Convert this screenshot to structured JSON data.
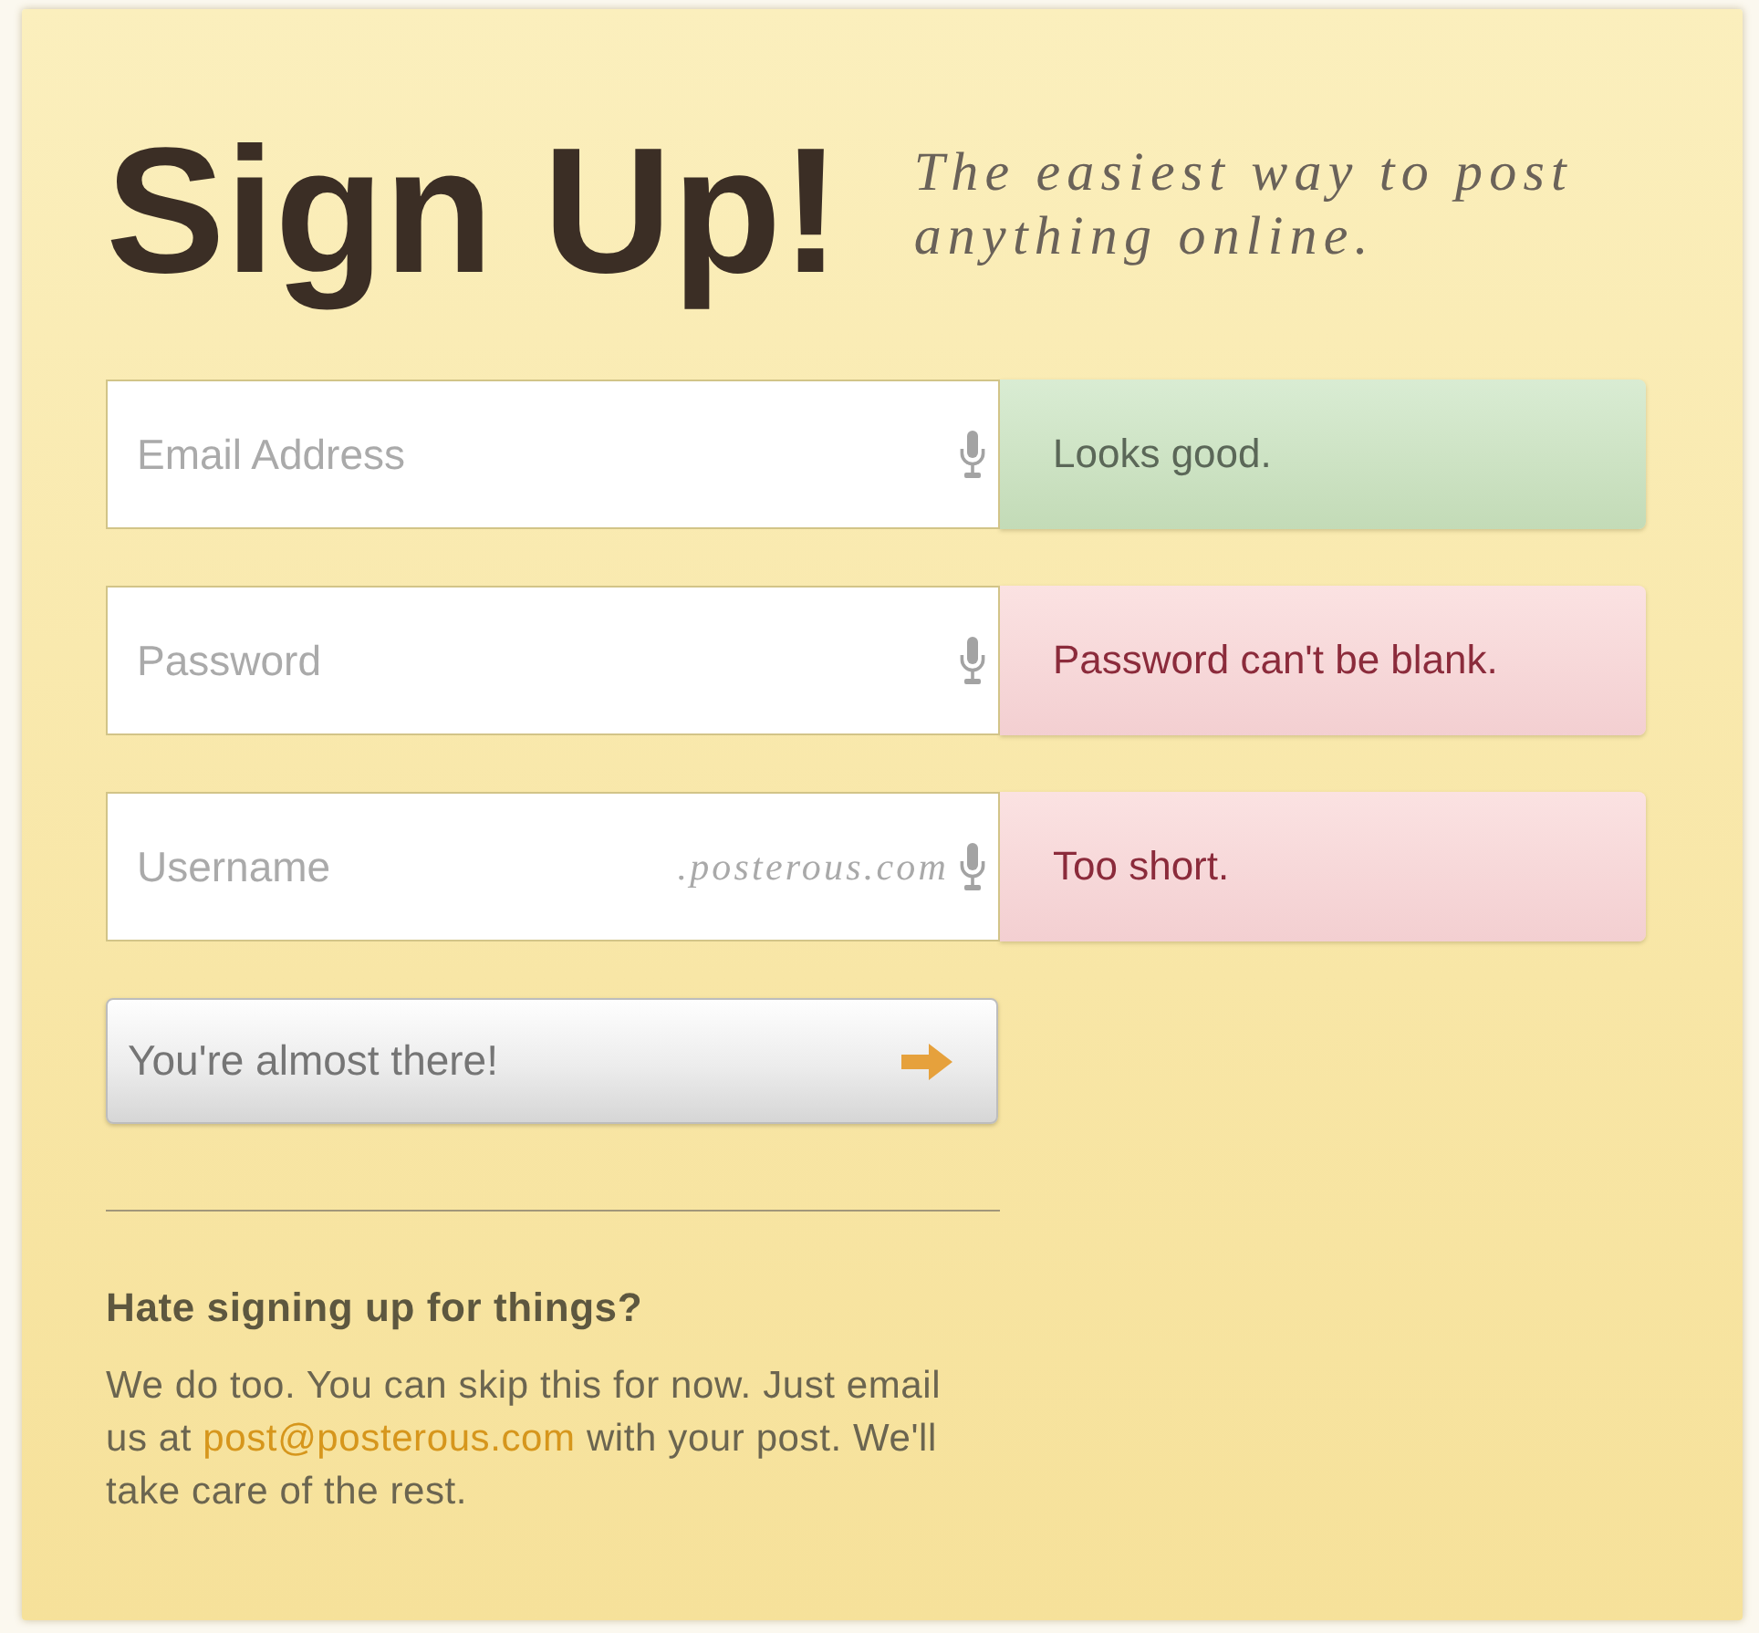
{
  "header": {
    "title": "Sign Up!",
    "tagline": "The easiest way to post anything online."
  },
  "fields": [
    {
      "placeholder": "Email Address",
      "message": "Looks good.",
      "valid": true
    },
    {
      "placeholder": "Password",
      "message": "Password can't be blank.",
      "valid": false
    },
    {
      "placeholder": "Username",
      "suffix": ".posterous.com",
      "message": "Too short.",
      "valid": false
    }
  ],
  "submit_button": {
    "label": "You're almost there!"
  },
  "alternative": {
    "heading": "Hate signing up for things?",
    "text": "We do too. You can skip this for now. Just email us at ",
    "link": "post@posterous.com",
    "text_after": " with your post. We'll take care of the rest."
  }
}
